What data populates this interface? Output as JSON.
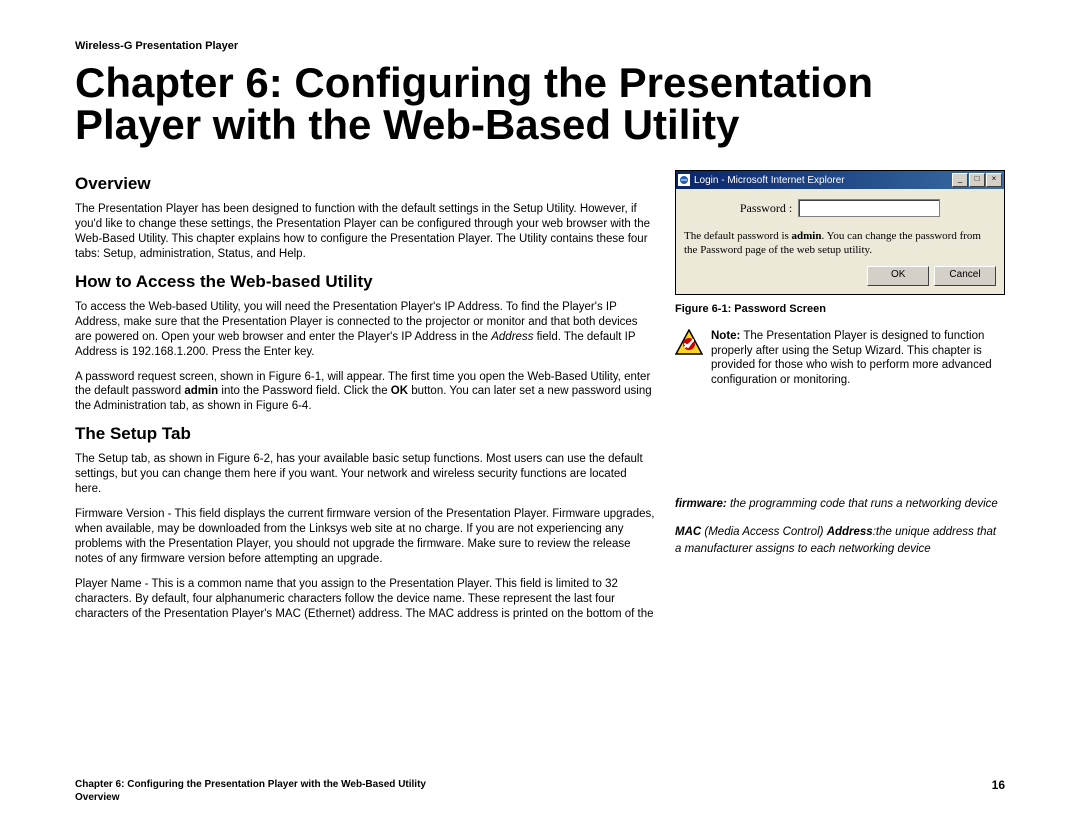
{
  "product_header": "Wireless-G Presentation Player",
  "chapter_title": "Chapter 6: Configuring the Presentation Player with the Web-Based Utility",
  "sections": {
    "overview": {
      "heading": "Overview",
      "p1": "The Presentation Player has been designed to function with the default settings in the Setup Utility. However, if you'd like to change these settings, the Presentation Player can be configured through your web browser with the Web-Based Utility. This chapter explains how to configure the Presentation Player. The Utility contains these four tabs: Setup, administration, Status, and Help."
    },
    "access": {
      "heading": "How to Access the Web-based Utility",
      "p1_pre": "To access the Web-based Utility, you will need the Presentation Player's IP Address. To find the Player's IP Address, make sure that the Presentation Player is connected to the projector or monitor and that both devices are powered on. Open your web browser and enter the Player's IP Address in the ",
      "p1_italic": "Address",
      "p1_post": " field. The default IP Address is 192.168.1.200. Press the Enter key.",
      "p2_pre": "A password request screen, shown in Figure 6-1, will appear. The first time you open the Web-Based Utility, enter the default password ",
      "p2_bold1": "admin",
      "p2_mid": " into the Password field. Click the ",
      "p2_bold2": "OK",
      "p2_post": " button.  You can later set a new password using the Administration tab, as shown in Figure 6-4."
    },
    "setup": {
      "heading": "The Setup Tab",
      "p1": "The Setup tab, as shown in Figure 6-2, has your available basic setup functions. Most users can use the default settings, but you can change them here if you want. Your network and wireless security functions are located here.",
      "p2": "Firmware Version -  This field displays the current firmware version of the Presentation Player.  Firmware upgrades, when available, may be downloaded from the Linksys web site at no charge.  If you are not experiencing any problems with the Presentation Player, you should not upgrade the firmware.  Make  sure to review the release notes of any firmware version before attempting an upgrade.",
      "p3": "Player Name - This is a common name that you assign to the Presentation Player.  This field is limited to 32 characters.  By default, four alphanumeric characters follow the device name.  These represent the last four characters of the Presentation Player's MAC (Ethernet) address.  The MAC address is printed on the bottom of the"
    }
  },
  "figure": {
    "titlebar": "Login - Microsoft Internet Explorer",
    "password_label": "Password :",
    "help_pre": "The default password is ",
    "help_bold": "admin",
    "help_post": ". You can change the password from the Password page of the web setup utility.",
    "ok": "OK",
    "cancel": "Cancel",
    "caption": "Figure 6-1: Password Screen"
  },
  "note": {
    "bold": "Note:",
    "text": " The Presentation Player is designed to function properly after using the Setup Wizard. This chapter is provided for those who wish to perform more advanced configuration or monitoring."
  },
  "glossary": {
    "g1_bold": "firmware:",
    "g1_text": " the programming code that runs a networking device",
    "g2_bold1": "MAC",
    "g2_i1": " (Media Access Control) ",
    "g2_bold2": "Address",
    "g2_i2": ":the unique address that a manufacturer assigns to each networking device"
  },
  "footer": {
    "line1": "Chapter 6: Configuring the Presentation Player with the Web-Based Utility",
    "line2": "Overview",
    "page": "16"
  }
}
